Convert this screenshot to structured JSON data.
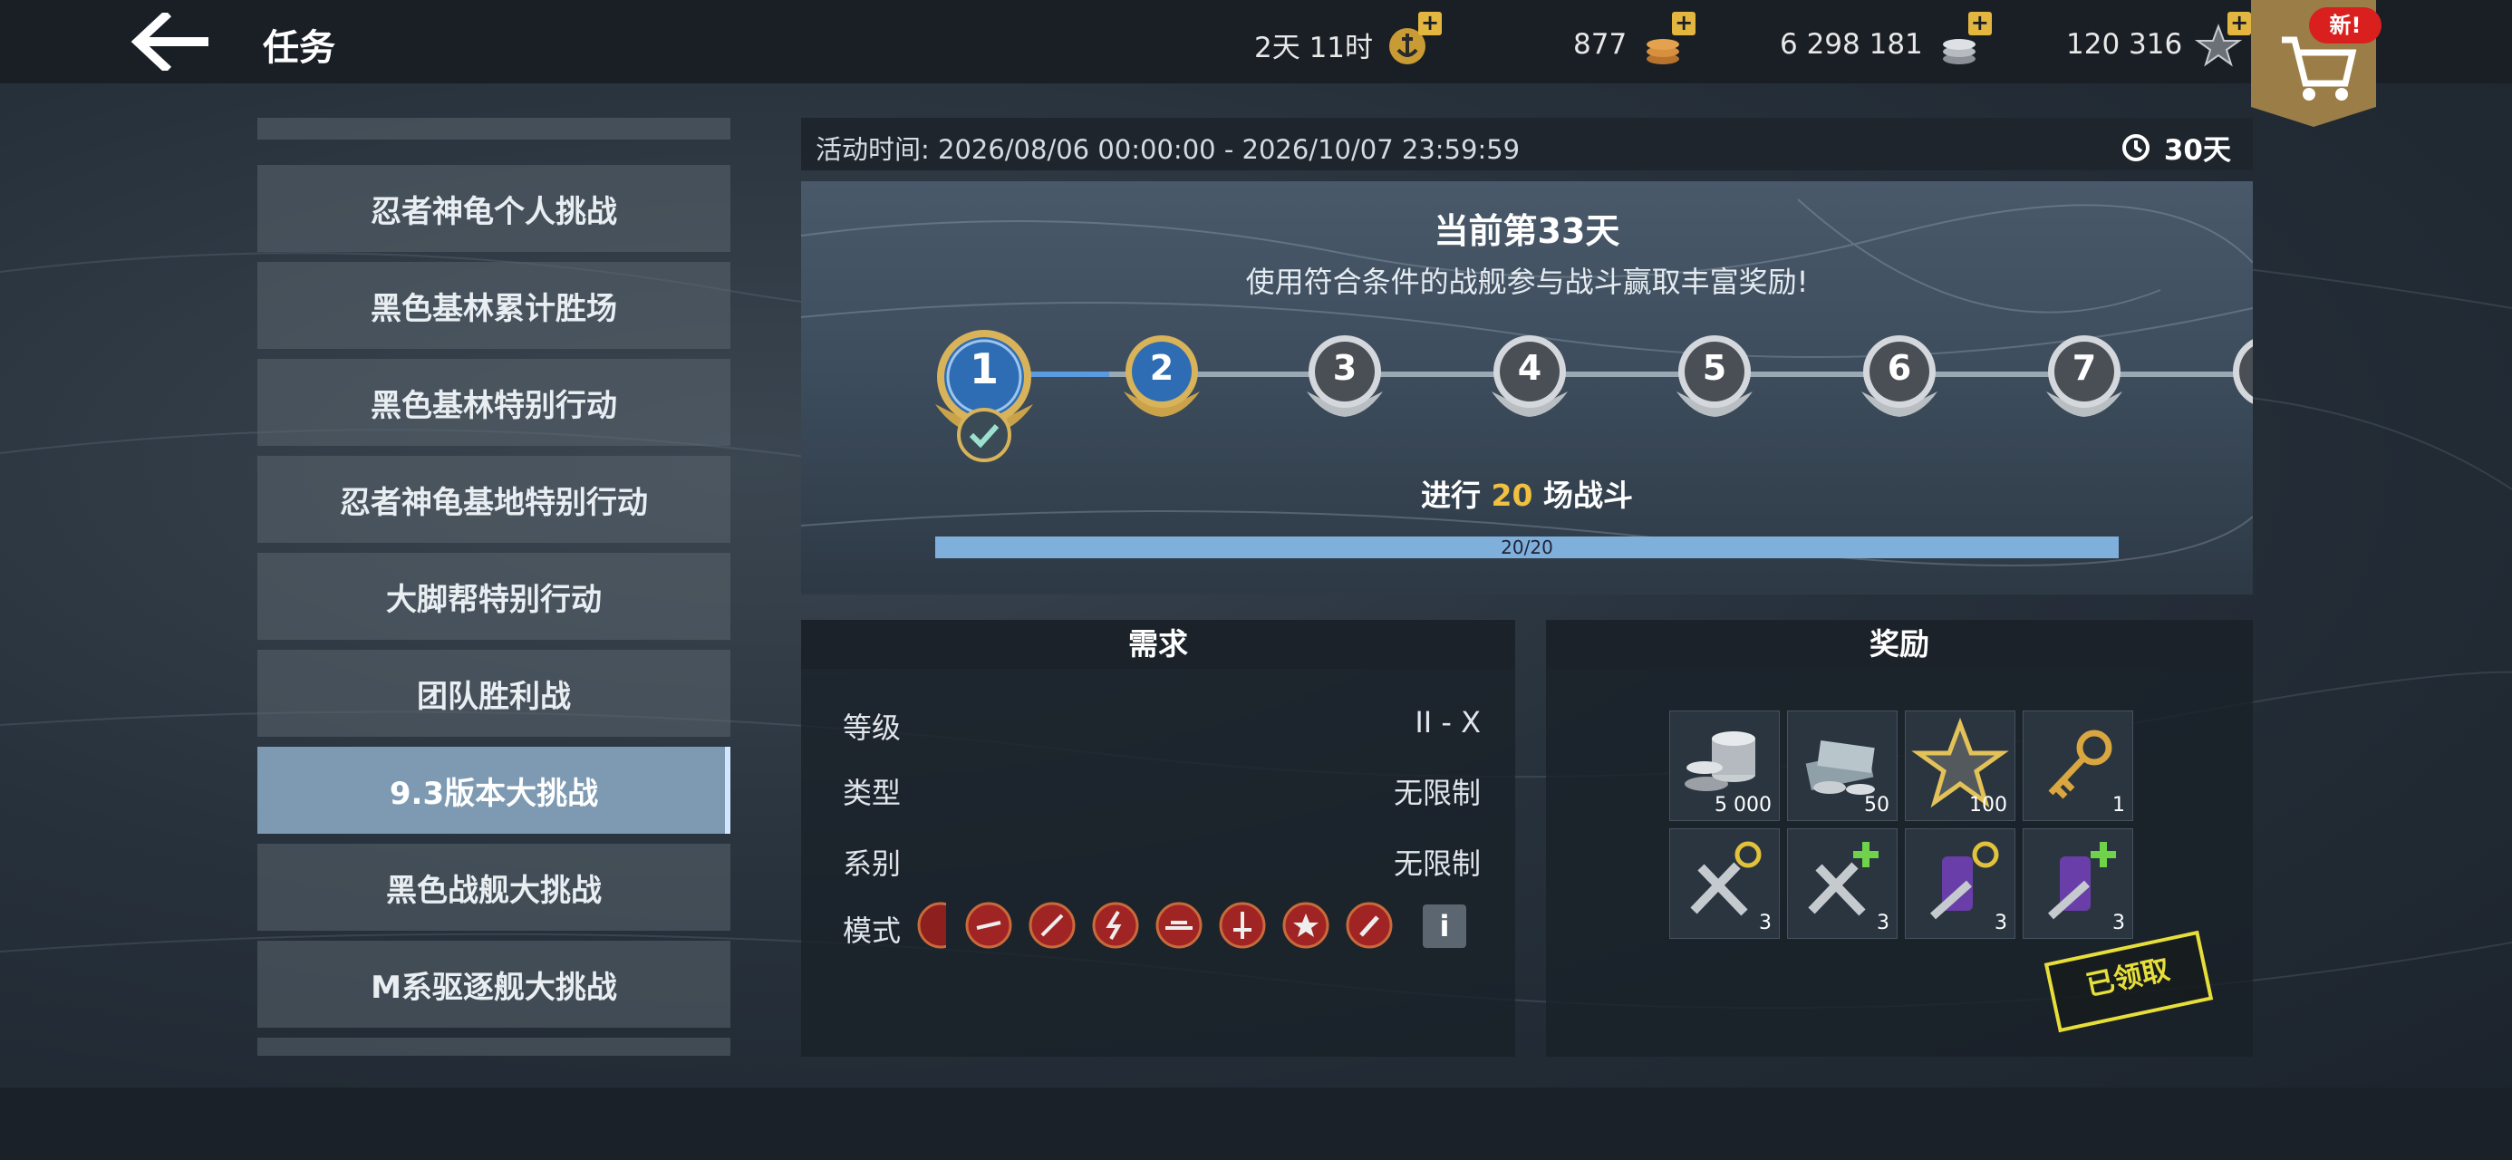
{
  "header": {
    "title": "任务",
    "timer": "2天 11时",
    "gold": "877",
    "silver": "6 298 181",
    "free_xp": "120 316",
    "new_badge": "新!"
  },
  "sidebar": {
    "items": [
      {
        "label": "忍者神龟个人挑战"
      },
      {
        "label": "黑色基林累计胜场"
      },
      {
        "label": "黑色基林特别行动"
      },
      {
        "label": "忍者神龟基地特别行动"
      },
      {
        "label": "大脚帮特别行动"
      },
      {
        "label": "团队胜利战"
      },
      {
        "label": "9.3版本大挑战"
      },
      {
        "label": "黑色战舰大挑战"
      },
      {
        "label": "M系驱逐舰大挑战"
      }
    ],
    "active_index": 6
  },
  "event": {
    "time_label": "活动时间: 2026/08/06 00:00:00 - 2026/10/07 23:59:59",
    "days_left": "30天",
    "current_day": "当前第33天",
    "subtitle": "使用符合条件的战舰参与战斗赢取丰富奖励!",
    "stages": [
      "1",
      "2",
      "3",
      "4",
      "5",
      "6",
      "7"
    ],
    "completed_stage": "1",
    "selected_stage": "2",
    "battle_prefix": "进行",
    "battle_count": "20",
    "battle_suffix": "场战斗",
    "progress_text": "20/20",
    "progress": 1.0
  },
  "requirements": {
    "header": "需求",
    "tier_label": "等级",
    "tier_value": "II - X",
    "type_label": "类型",
    "type_value": "无限制",
    "nation_label": "系别",
    "nation_value": "无限制",
    "mode_label": "模式",
    "modes": [
      "mode-icon",
      "mode-icon",
      "mode-icon",
      "mode-icon",
      "mode-icon",
      "mode-icon",
      "mode-icon",
      "mode-icon"
    ],
    "info_button": "i"
  },
  "rewards": {
    "header": "奖励",
    "items": [
      {
        "icon": "silver-credits-icon",
        "count": "5 000"
      },
      {
        "icon": "credits-stack-icon",
        "count": "50"
      },
      {
        "icon": "star-icon",
        "count": "100"
      },
      {
        "icon": "key-icon",
        "count": "1"
      },
      {
        "icon": "repair-kit-icon",
        "count": "3"
      },
      {
        "icon": "repair-plus-icon",
        "count": "3"
      },
      {
        "icon": "damage-control-icon",
        "count": "3"
      },
      {
        "icon": "damage-control-plus-icon",
        "count": "3"
      }
    ],
    "claimed_label": "已领取"
  },
  "colors": {
    "accent_blue": "#5a9be0",
    "gold": "#f0c040",
    "active_tab": "#7d9ab2",
    "claimed_stamp": "#e6df3a"
  }
}
